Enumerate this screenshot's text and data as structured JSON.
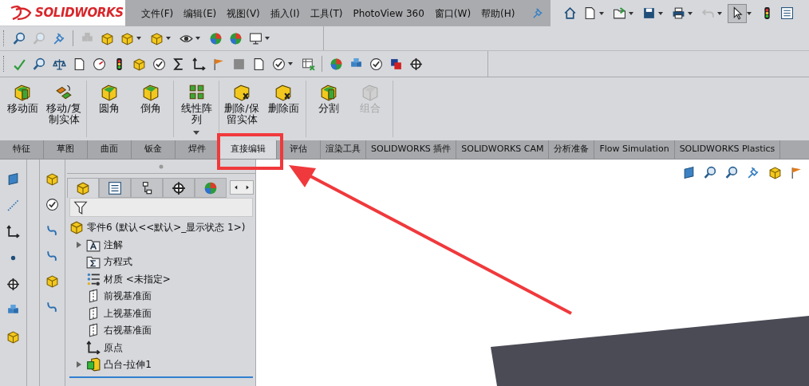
{
  "logo": {
    "text": "SOLIDWORKS"
  },
  "menu": [
    {
      "label": "文件(F)"
    },
    {
      "label": "编辑(E)"
    },
    {
      "label": "视图(V)"
    },
    {
      "label": "插入(I)"
    },
    {
      "label": "工具(T)"
    },
    {
      "label": "PhotoView 360"
    },
    {
      "label": "窗口(W)"
    },
    {
      "label": "帮助(H)"
    }
  ],
  "ribbon": {
    "groups": [
      {
        "buttons": [
          {
            "label": "移动面",
            "disabled": false,
            "dropdown": false
          },
          {
            "label": "移动/复制实体",
            "disabled": false,
            "dropdown": false
          }
        ]
      },
      {
        "buttons": [
          {
            "label": "圆角",
            "disabled": false,
            "dropdown": false
          },
          {
            "label": "倒角",
            "disabled": false,
            "dropdown": false
          }
        ]
      },
      {
        "buttons": [
          {
            "label": "线性阵列",
            "disabled": false,
            "dropdown": true
          }
        ]
      },
      {
        "buttons": [
          {
            "label": "删除/保留实体",
            "disabled": false,
            "dropdown": false
          },
          {
            "label": "删除面",
            "disabled": false,
            "dropdown": false
          }
        ]
      },
      {
        "buttons": [
          {
            "label": "分割",
            "disabled": false,
            "dropdown": false
          },
          {
            "label": "组合",
            "disabled": true,
            "dropdown": false
          }
        ]
      }
    ]
  },
  "panel_tabs": [
    {
      "selected": true
    },
    {
      "selected": false
    },
    {
      "selected": false
    },
    {
      "selected": false
    },
    {
      "selected": false
    }
  ],
  "tabs": [
    {
      "label": "特征",
      "selected": false
    },
    {
      "label": "草图",
      "selected": false
    },
    {
      "label": "曲面",
      "selected": false
    },
    {
      "label": "钣金",
      "selected": false
    },
    {
      "label": "焊件",
      "selected": false
    },
    {
      "label": "直接编辑",
      "selected": true
    },
    {
      "label": "评估",
      "selected": false
    },
    {
      "label": "渲染工具",
      "selected": false
    },
    {
      "label": "SOLIDWORKS 插件",
      "selected": false
    },
    {
      "label": "SOLIDWORKS CAM",
      "selected": false
    },
    {
      "label": "分析准备",
      "selected": false
    },
    {
      "label": "Flow Simulation",
      "selected": false
    },
    {
      "label": "SOLIDWORKS Plastics",
      "selected": false
    }
  ],
  "feature_tree": {
    "root": "零件6  (默认<<默认>_显示状态 1>)",
    "items": [
      {
        "label": "注解",
        "kind": "annotation",
        "expandable": true
      },
      {
        "label": "方程式",
        "kind": "equation",
        "expandable": false
      },
      {
        "label": "材质 <未指定>",
        "kind": "material",
        "expandable": false
      },
      {
        "label": "前视基准面",
        "kind": "plane",
        "expandable": false
      },
      {
        "label": "上视基准面",
        "kind": "plane",
        "expandable": false
      },
      {
        "label": "右视基准面",
        "kind": "plane",
        "expandable": false
      },
      {
        "label": "原点",
        "kind": "origin",
        "expandable": false
      },
      {
        "label": "凸台-拉伸1",
        "kind": "feature",
        "expandable": true
      }
    ]
  }
}
